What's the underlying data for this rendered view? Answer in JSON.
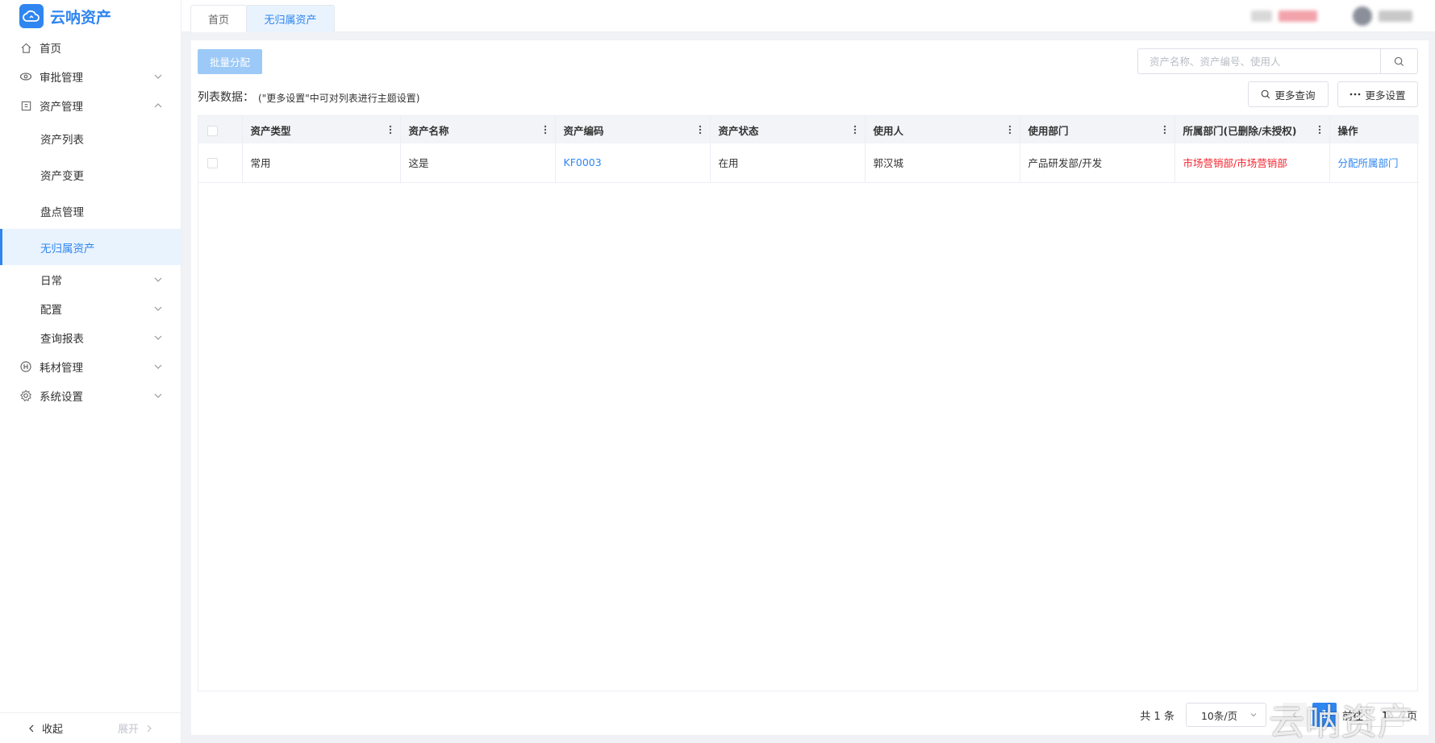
{
  "app": {
    "name": "云呐资产"
  },
  "colors": {
    "primary": "#2f86f0",
    "danger": "#f5222d",
    "batch_disabled": "#9cc9f7"
  },
  "sidebar": {
    "items": [
      {
        "label": "首页",
        "icon": "home-icon"
      },
      {
        "label": "审批管理",
        "icon": "eye-icon"
      },
      {
        "label": "资产管理",
        "icon": "asset-icon"
      },
      {
        "label": "资产列表"
      },
      {
        "label": "资产变更"
      },
      {
        "label": "盘点管理"
      },
      {
        "label": "无归属资产"
      },
      {
        "label": "日常"
      },
      {
        "label": "配置"
      },
      {
        "label": "查询报表"
      },
      {
        "label": "耗材管理",
        "icon": "consumable-icon"
      },
      {
        "label": "系统设置",
        "icon": "gear-icon"
      }
    ],
    "collapse_label": "收起",
    "expand_label": "展开"
  },
  "tabs": [
    {
      "label": "首页"
    },
    {
      "label": "无归属资产"
    }
  ],
  "toolbar": {
    "batch_label": "批量分配",
    "search_placeholder": "资产名称、资产编号、使用人",
    "list_label": "列表数据：",
    "list_hint": "(\"更多设置\"中可对列表进行主题设置)",
    "more_query": "更多查询",
    "more_settings": "更多设置"
  },
  "table": {
    "columns": [
      "资产类型",
      "资产名称",
      "资产编码",
      "资产状态",
      "使用人",
      "使用部门",
      "所属部门(已删除/未授权)",
      "操作"
    ],
    "rows": [
      {
        "type": "常用",
        "name": "这是",
        "code": "KF0003",
        "status": "在用",
        "user": "郭汉城",
        "dept": "产品研发部/开发",
        "owner_dept": "市场营销部/市场营销部",
        "action": "分配所属部门"
      }
    ]
  },
  "pagination": {
    "total": "共 1 条",
    "page_size": "10条/页",
    "current": "1",
    "goto_label": "前往",
    "goto_value": "1",
    "page_suffix": "页"
  },
  "watermark": "云呐资产"
}
